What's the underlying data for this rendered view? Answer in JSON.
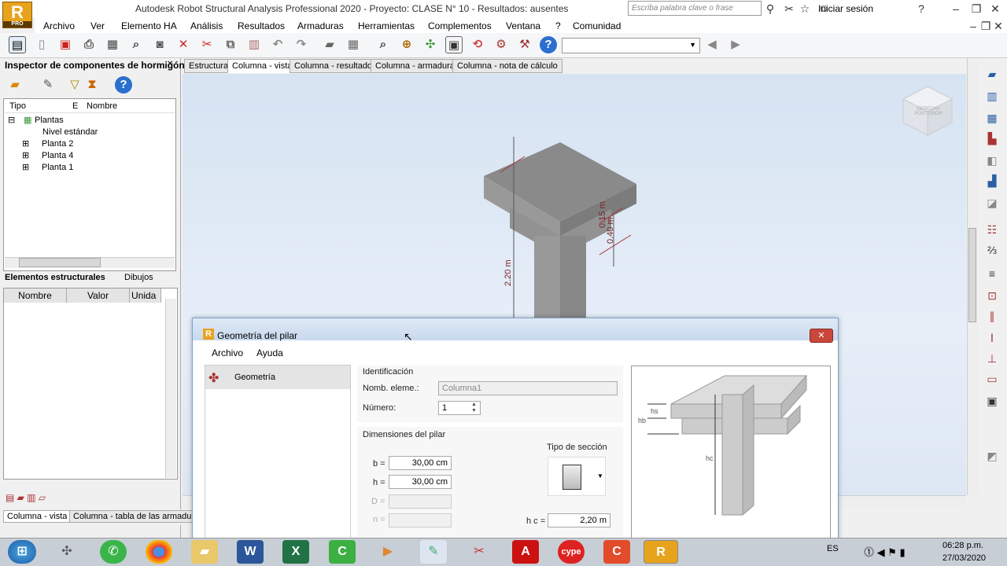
{
  "app": {
    "title": "Autodesk Robot Structural Analysis Professional 2020 - Proyecto: CLASE N° 10 - Resultados: ausentes",
    "logo_text": "R",
    "logo_sub": "PRO",
    "search_placeholder": "Escriba palabra clave o frase",
    "login": "Iniciar sesión"
  },
  "menu": [
    "Archivo",
    "Ver",
    "Elemento HA",
    "Análisis",
    "Resultados",
    "Armaduras",
    "Herramientas",
    "Complementos",
    "Ventana",
    "?",
    "Comunidad"
  ],
  "left": {
    "inspector_title": "Inspector de componentes de hormigón",
    "tree_headers": [
      "Tipo",
      "E",
      "Nombre"
    ],
    "tree_items": [
      "Plantas",
      "Nivel estándar",
      "Planta 2",
      "Planta 4",
      "Planta 1"
    ],
    "panel_tabs": [
      "Elementos estructurales",
      "Dibujos"
    ],
    "prop_headers": [
      "Nombre",
      "Valor",
      "Unida"
    ]
  },
  "tabs": [
    "Estructura",
    "Columna - vista",
    "Columna - resultados",
    "Columna - armaduras",
    "Columna - nota de cálculo"
  ],
  "bottom_tabs": [
    "Columna - vista",
    "Columna - tabla de las armaduras"
  ],
  "viewport": {
    "dim_height": "2.20 m",
    "dim_a": "0.15 m",
    "dim_b": "0.40 m",
    "viewcube": "DERECHA POSTERIOR"
  },
  "dialog": {
    "title": "Geometría del pilar",
    "menu": [
      "Archivo",
      "Ayuda"
    ],
    "nav_item": "Geometría",
    "ident_title": "Identificación",
    "nomb_label": "Nomb. eleme.:",
    "nomb_value": "Columna1",
    "numero_label": "Número:",
    "numero_value": "1",
    "dims_title": "Dimensiones del pilar",
    "b_label": "b =",
    "b_value": "30,00 cm",
    "h_label": "h =",
    "h_value": "30,00 cm",
    "d_label": "D =",
    "n_label": "n =",
    "section_type": "Tipo de sección",
    "hc_label": "h c =",
    "hc_value": "2,20 m",
    "diagram_labels": {
      "hs": "hs",
      "hb": "hb",
      "hc": "hc"
    }
  },
  "taskbar": {
    "lang": "ES",
    "time": "06:28 p.m.",
    "date": "27/03/2020"
  }
}
